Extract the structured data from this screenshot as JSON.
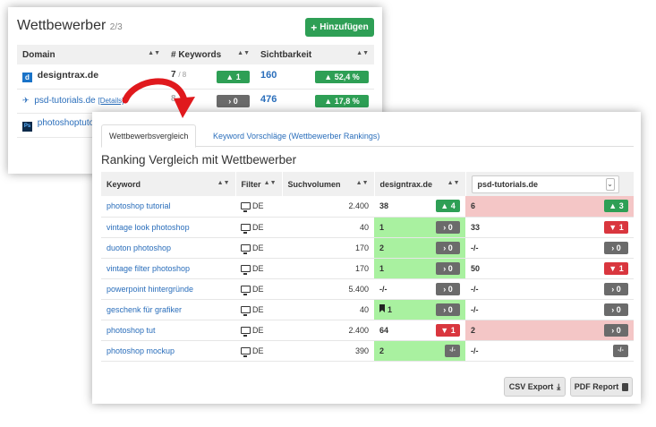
{
  "competitors": {
    "title": "Wettbewerber",
    "count": "2/3",
    "add_label": "Hinzufügen",
    "headers": [
      "Domain",
      "# Keywords",
      "Sichtbarkeit"
    ],
    "rows": [
      {
        "domain": "designtrax.de",
        "keywords": "7",
        "keywords_total": "/ 8",
        "kw_badge": "1",
        "visibility": "160",
        "vis_badge": "52,4 %"
      },
      {
        "domain": "psd-tutorials.de",
        "details": "[Details]",
        "keywords": "8",
        "kw_badge": "0",
        "visibility": "476",
        "vis_badge": "17,8 %"
      },
      {
        "domain": "photoshoptutor"
      }
    ]
  },
  "comparison": {
    "tabs": [
      "Wettbewerbsvergleich",
      "Keyword Vorschläge (Wettbewerber Rankings)"
    ],
    "title": "Ranking Vergleich mit Wettbewerber",
    "headers": [
      "Keyword",
      "Filter",
      "Suchvolumen",
      "designtrax.de"
    ],
    "competitor_select": "psd-tutorials.de",
    "rows": [
      {
        "keyword": "photoshop tutorial",
        "filter": "DE",
        "volume": "2.400",
        "own_rank": "38",
        "own_badge": "4",
        "own_type": "up-green",
        "comp_rank": "6",
        "comp_badge": "3",
        "comp_type": "up-green",
        "own_bg": "",
        "comp_bg": "red"
      },
      {
        "keyword": "vintage look photoshop",
        "filter": "DE",
        "volume": "40",
        "own_rank": "1",
        "own_badge": "0",
        "own_type": "gray",
        "comp_rank": "33",
        "comp_badge": "1",
        "comp_type": "down-red",
        "own_bg": "green",
        "comp_bg": ""
      },
      {
        "keyword": "duoton photoshop",
        "filter": "DE",
        "volume": "170",
        "own_rank": "2",
        "own_badge": "0",
        "own_type": "gray",
        "comp_rank": "-/-",
        "comp_badge": "0",
        "comp_type": "gray",
        "own_bg": "green",
        "comp_bg": ""
      },
      {
        "keyword": "vintage filter photoshop",
        "filter": "DE",
        "volume": "170",
        "own_rank": "1",
        "own_badge": "0",
        "own_type": "gray",
        "comp_rank": "50",
        "comp_badge": "1",
        "comp_type": "down-red",
        "own_bg": "green",
        "comp_bg": ""
      },
      {
        "keyword": "powerpoint hintergründe",
        "filter": "DE",
        "volume": "5.400",
        "own_rank": "-/-",
        "own_badge": "0",
        "own_type": "gray",
        "comp_rank": "-/-",
        "comp_badge": "0",
        "comp_type": "gray",
        "own_bg": "",
        "comp_bg": ""
      },
      {
        "keyword": "geschenk für grafiker",
        "filter": "DE",
        "volume": "40",
        "own_rank": "1",
        "own_badge": "0",
        "own_type": "gray",
        "own_bookmark": true,
        "comp_rank": "-/-",
        "comp_badge": "0",
        "comp_type": "gray",
        "own_bg": "green",
        "comp_bg": ""
      },
      {
        "keyword": "photoshop tut",
        "filter": "DE",
        "volume": "2.400",
        "own_rank": "64",
        "own_badge": "1",
        "own_type": "down-red",
        "comp_rank": "2",
        "comp_badge": "0",
        "comp_type": "gray",
        "own_bg": "",
        "comp_bg": "red"
      },
      {
        "keyword": "photoshop mockup",
        "filter": "DE",
        "volume": "390",
        "own_rank": "2",
        "own_badge": "-/-",
        "own_type": "plain",
        "comp_rank": "-/-",
        "comp_badge": "-/-",
        "comp_type": "plain",
        "own_bg": "green",
        "comp_bg": ""
      }
    ],
    "csv_label": "CSV Export",
    "pdf_label": "PDF Report"
  },
  "colors": {
    "green": "#2e9f55",
    "red": "#d9363e",
    "gray": "#6b6b6b",
    "link": "#2a6ebb",
    "row_green": "#a9f1a0",
    "row_red": "#f4c6c6"
  }
}
